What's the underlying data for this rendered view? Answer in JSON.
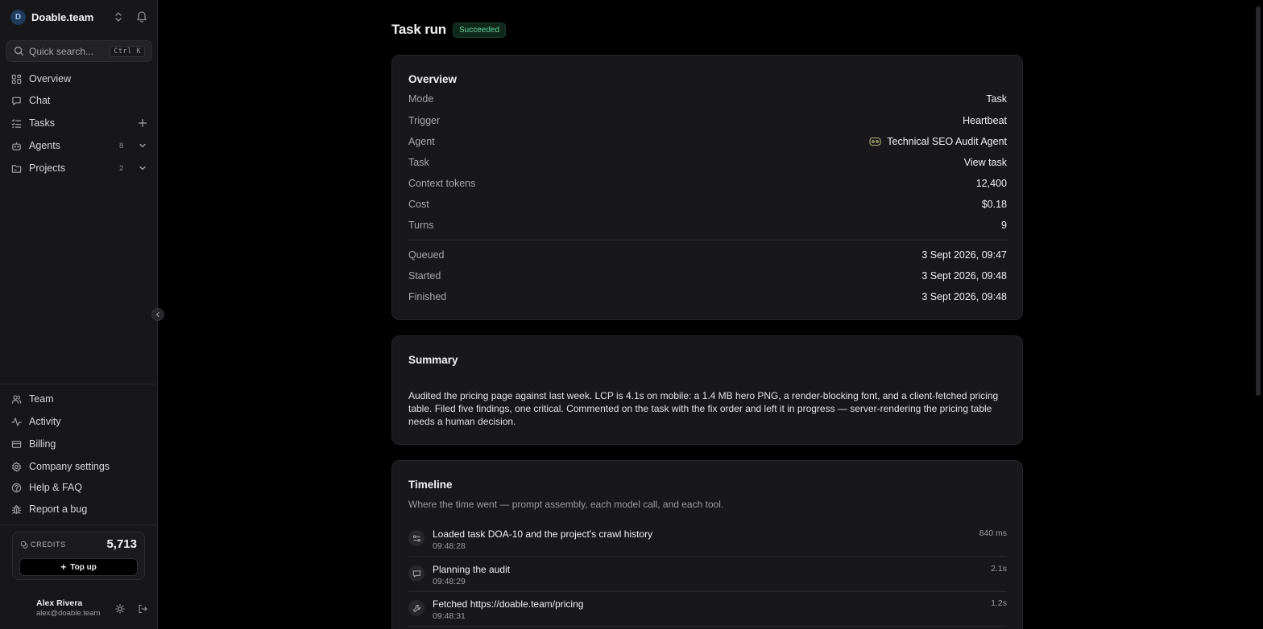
{
  "workspace": {
    "initial": "D",
    "name": "Doable.team"
  },
  "search": {
    "placeholder": "Quick search...",
    "shortcut": "Ctrl K"
  },
  "nav": {
    "overview": "Overview",
    "chat": "Chat",
    "tasks": "Tasks",
    "agents": "Agents",
    "agents_count": "8",
    "projects": "Projects",
    "projects_count": "2"
  },
  "bottom_nav": {
    "team": "Team",
    "activity": "Activity",
    "billing": "Billing",
    "company_settings": "Company settings",
    "help": "Help & FAQ",
    "report_bug": "Report a bug"
  },
  "credits": {
    "label": "CREDITS",
    "value": "5,713",
    "top_up": "Top up"
  },
  "user": {
    "name": "Alex Rivera",
    "email": "alex@doable.team"
  },
  "page": {
    "title": "Task run",
    "status": "Succeeded"
  },
  "overview": {
    "title": "Overview",
    "rows": [
      {
        "key": "Mode",
        "value": "Task"
      },
      {
        "key": "Trigger",
        "value": "Heartbeat"
      },
      {
        "key": "Agent",
        "value": "Technical SEO Audit Agent"
      },
      {
        "key": "Task",
        "value": "View task"
      },
      {
        "key": "Context tokens",
        "value": "12,400"
      },
      {
        "key": "Cost",
        "value": "$0.18"
      },
      {
        "key": "Turns",
        "value": "9"
      }
    ],
    "times": [
      {
        "key": "Queued",
        "value": "3 Sept 2026, 09:47"
      },
      {
        "key": "Started",
        "value": "3 Sept 2026, 09:48"
      },
      {
        "key": "Finished",
        "value": "3 Sept 2026, 09:48"
      }
    ]
  },
  "summary": {
    "title": "Summary",
    "text": "Audited the pricing page against last week. LCP is 4.1s on mobile: a 1.4 MB hero PNG, a render-blocking font, and a client-fetched pricing table. Filed five findings, one critical. Commented on the task with the fix order and left it in progress — server-rendering the pricing table needs a human decision."
  },
  "timeline": {
    "title": "Timeline",
    "subtitle": "Where the time went — prompt assembly, each model call, and each tool.",
    "items": [
      {
        "title": "Loaded task DOA-10 and the project's crawl history",
        "time": "09:48:28",
        "duration": "840 ms",
        "icon": "assembly-icon"
      },
      {
        "title": "Planning the audit",
        "time": "09:48:29",
        "duration": "2.1s",
        "icon": "chat-bubble-icon"
      },
      {
        "title": "Fetched https://doable.team/pricing",
        "time": "09:48:31",
        "duration": "1.2s",
        "icon": "wrench-icon"
      }
    ]
  }
}
